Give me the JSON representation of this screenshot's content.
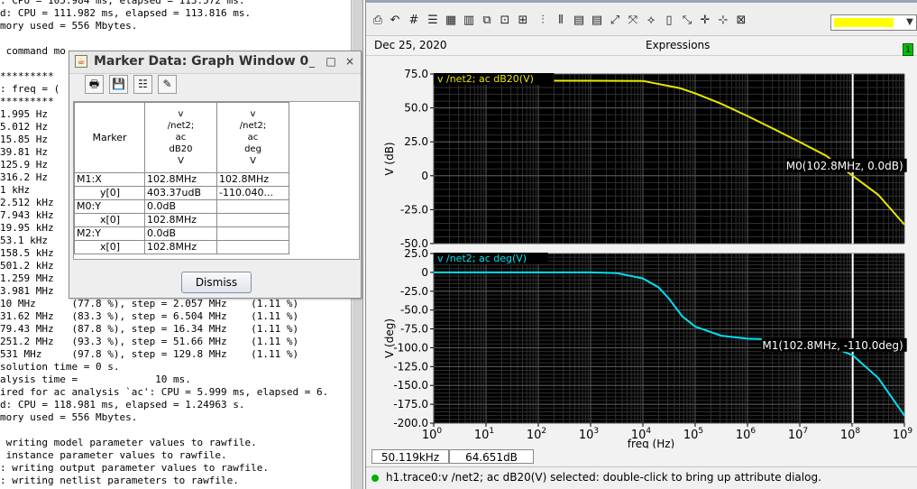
{
  "terminal": {
    "lines": [
      ": CPU = 105.984 ms, elapsed = 113.572 ms.",
      "d: CPU = 111.982 ms, elapsed = 113.816 ms.",
      "mory used = 556 Mbytes.",
      "",
      " command mo",
      "",
      "*********",
      ": freq = (",
      "*********",
      "1.995 Hz",
      "5.012 Hz",
      "15.85 Hz",
      "39.81 Hz",
      "125.9 Hz",
      "316.2 Hz",
      "1 kHz",
      "2.512 kHz",
      "7.943 kHz",
      "19.95 kHz",
      "53.1 kHz",
      "158.5 kHz",
      "501.2 kHz",
      "1.259 MHz",
      "3.981 MHz",
      "10 MHz      (77.8 %), step = 2.057 MHz    (1.11 %)",
      "31.62 MHz   (83.3 %), step = 6.504 MHz    (1.11 %)",
      "79.43 MHz   (87.8 %), step = 16.34 MHz    (1.11 %)",
      "251.2 MHz   (93.3 %), step = 51.66 MHz    (1.11 %)",
      "531 MHz     (97.8 %), step = 129.8 MHz    (1.11 %)",
      "solution time = 0 s.",
      "alysis time =             10 ms.",
      "ired for ac analysis `ac': CPU = 5.999 ms, elapsed = 6.",
      "d: CPU = 118.981 ms, elapsed = 1.24963 s.",
      "mory used = 556 Mbytes.",
      "",
      " writing model parameter values to rawfile.",
      " instance parameter values to rawfile.",
      ": writing output parameter values to rawfile.",
      ": writing netlist parameters to rawfile."
    ]
  },
  "graph_window": {
    "date": "Dec 25, 2020",
    "expressions_label": "Expressions",
    "badge": "1",
    "color_swatch": "#ffff00",
    "toolbar_icons": [
      "print-icon",
      "undo-icon",
      "grid-icon",
      "strip-icon",
      "layout-icon",
      "copy-icon",
      "zoom-fit-icon",
      "zoom-window-icon",
      "bar-icon",
      "zoom-box-icon",
      "measure-icon",
      "hide-icon",
      "crosshair-icon",
      "expand-icon",
      "pan-icon",
      "zoom-all-icon",
      "delete-window-icon"
    ],
    "status_freq": "50.119kHz",
    "status_value": "64.651dB",
    "status_message": "h1.trace0:v /net2; ac dB20(V) selected: double-click to bring up attribute dialog.",
    "status_color": "#00b000"
  },
  "chart_data": [
    {
      "type": "line",
      "title": "v /net2; ac dB20(V)",
      "xlabel": "",
      "ylabel": "V (dB)",
      "xscale": "log",
      "xlim": [
        1,
        1000000000
      ],
      "ylim": [
        -50,
        75
      ],
      "yticks": [
        "75.0",
        "50.0",
        "25.0",
        "0",
        "-25.0",
        "-50.0"
      ],
      "ytick_values": [
        75,
        50,
        25,
        0,
        -25,
        -50
      ],
      "background": "#000000",
      "grid": true,
      "series": [
        {
          "name": "v /net2; ac dB20(V)",
          "color": "#e8e800",
          "x": [
            1,
            10,
            100,
            1000,
            10000,
            50119,
            100000,
            316200,
            1000000,
            3162000,
            10000000,
            31620000,
            102800000,
            316200000,
            1000000000
          ],
          "y": [
            70,
            70,
            70,
            70,
            69.9,
            64.65,
            60.8,
            53,
            44,
            34.5,
            24.8,
            14.8,
            0,
            -14,
            -36
          ]
        }
      ],
      "annotations": [
        {
          "label": "M0(102.8MHz, 0.0dB)",
          "x": 102800000,
          "y": 0
        }
      ],
      "vertical_marker_x": 102800000
    },
    {
      "type": "line",
      "title": "v /net2; ac deg(V)",
      "xlabel": "freq (Hz)",
      "ylabel": "V (deg)",
      "xscale": "log",
      "xlim": [
        1,
        1000000000
      ],
      "ylim": [
        -200,
        25
      ],
      "yticks": [
        "25.0",
        "0",
        "-25.0",
        "-50.0",
        "-75.0",
        "-100.0",
        "-125.0",
        "-150.0",
        "-175.0",
        "-200.0"
      ],
      "ytick_values": [
        25,
        0,
        -25,
        -50,
        -75,
        -100,
        -125,
        -150,
        -175,
        -200
      ],
      "xticks": [
        "10^0",
        "10^1",
        "10^2",
        "10^3",
        "10^4",
        "10^5",
        "10^6",
        "10^7",
        "10^8",
        "10^9"
      ],
      "xtick_values": [
        1,
        10,
        100,
        1000,
        10000,
        100000,
        1000000,
        10000000,
        100000000,
        1000000000
      ],
      "background": "#000000",
      "grid": true,
      "series": [
        {
          "name": "v /net2; ac deg(V)",
          "color": "#00e0f0",
          "x": [
            1,
            10,
            100,
            1000,
            3162,
            10000,
            20000,
            31620,
            56230,
            100000,
            316200,
            1000000,
            3162000,
            10000000,
            31620000,
            102800000,
            316200000,
            1000000000
          ],
          "y": [
            0,
            0,
            0,
            0,
            -1,
            -8,
            -20,
            -35,
            -58,
            -72,
            -84,
            -88,
            -89,
            -90.5,
            -96,
            -110,
            -140,
            -190
          ]
        }
      ],
      "annotations": [
        {
          "label": "M1(102.8MHz, -110.0deg)",
          "x": 102800000,
          "y": -110
        }
      ],
      "vertical_marker_x": 102800000
    }
  ],
  "marker_dialog": {
    "title": "Marker Data: Graph Window 0",
    "minimize": "_",
    "maximize": "□",
    "close": "×",
    "toolbar": [
      {
        "name": "print-icon",
        "glyph": "🖶"
      },
      {
        "name": "save-icon",
        "glyph": "💾"
      },
      {
        "name": "table-format-icon",
        "glyph": "☷"
      },
      {
        "name": "edit-icon",
        "glyph": "✎"
      }
    ],
    "table": {
      "header_col0": "Marker",
      "header_col1": "v\n/net2;\nac\ndB20\nV",
      "header_col2": "v\n/net2;\nac\ndeg\nV",
      "rows": [
        {
          "label": "M1:X",
          "c1": "102.8MHz",
          "c2": "102.8MHz",
          "sub": false
        },
        {
          "label": "y[0]",
          "c1": "403.37udB",
          "c2": "-110.040...",
          "sub": true
        },
        {
          "label": "M0:Y",
          "c1": "0.0dB",
          "c2": "",
          "sub": false
        },
        {
          "label": "x[0]",
          "c1": "102.8MHz",
          "c2": "",
          "sub": true
        },
        {
          "label": "M2:Y",
          "c1": "0.0dB",
          "c2": "",
          "sub": false
        },
        {
          "label": "x[0]",
          "c1": "102.8MHz",
          "c2": "",
          "sub": true
        }
      ]
    },
    "dismiss_label": "Dismiss"
  }
}
